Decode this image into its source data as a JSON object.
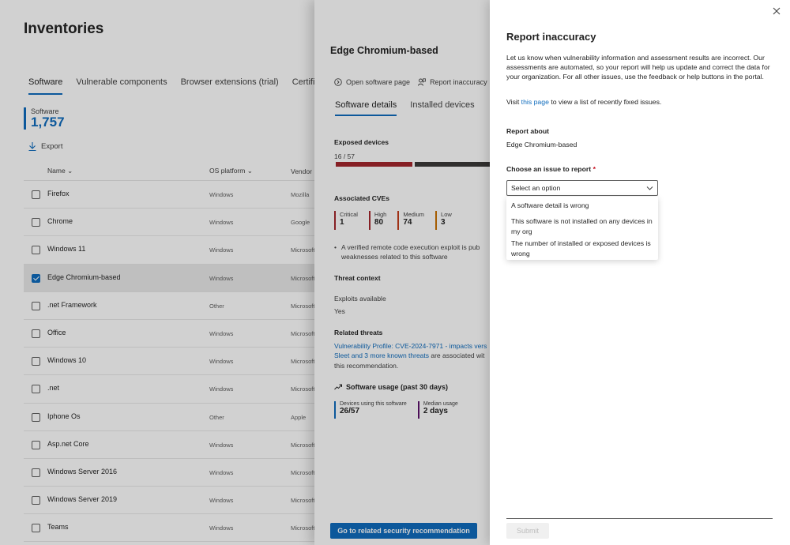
{
  "page": {
    "title": "Inventories",
    "tabs": [
      "Software",
      "Vulnerable components",
      "Browser extensions (trial)",
      "Certificates"
    ],
    "count_label": "Software",
    "count_value": "1,757",
    "export_label": "Export",
    "columns": {
      "name": "Name",
      "os": "OS platform",
      "vendor": "Vendor"
    },
    "rows": [
      {
        "name": "Firefox",
        "os": "Windows",
        "vendor": "Mozilla"
      },
      {
        "name": "Chrome",
        "os": "Windows",
        "vendor": "Google"
      },
      {
        "name": "Windows 11",
        "os": "Windows",
        "vendor": "Microsoft"
      },
      {
        "name": "Edge Chromium-based",
        "os": "Windows",
        "vendor": "Microsoft"
      },
      {
        "name": ".net Framework",
        "os": "Other",
        "vendor": "Microsoft"
      },
      {
        "name": "Office",
        "os": "Windows",
        "vendor": "Microsoft"
      },
      {
        "name": "Windows 10",
        "os": "Windows",
        "vendor": "Microsoft"
      },
      {
        "name": ".net",
        "os": "Windows",
        "vendor": "Microsoft"
      },
      {
        "name": "Iphone Os",
        "os": "Other",
        "vendor": "Apple"
      },
      {
        "name": "Asp.net Core",
        "os": "Windows",
        "vendor": "Microsoft"
      },
      {
        "name": "Windows Server 2016",
        "os": "Windows",
        "vendor": "Microsoft"
      },
      {
        "name": "Windows Server 2019",
        "os": "Windows",
        "vendor": "Microsoft"
      },
      {
        "name": "Teams",
        "os": "Windows",
        "vendor": "Microsoft"
      }
    ],
    "selected_row_index": 3
  },
  "panel": {
    "title": "Edge Chromium-based",
    "open_page": "Open software page",
    "report_inaccuracy": "Report inaccuracy",
    "tabs": [
      "Software details",
      "Installed devices"
    ],
    "exposed_devices_label": "Exposed devices",
    "exposed_fraction": "16 / 57",
    "exposed_count": 16,
    "total_devices": 57,
    "cves_label": "Associated CVEs",
    "cves": [
      {
        "label": "Critical",
        "value": "1",
        "color": "#a4262c"
      },
      {
        "label": "High",
        "value": "80",
        "color": "#a4262c"
      },
      {
        "label": "Medium",
        "value": "74",
        "color": "#c43e1c"
      },
      {
        "label": "Low",
        "value": "3",
        "color": "#ca7100"
      }
    ],
    "bullet_line1": "A verified remote code execution exploit is pub",
    "bullet_line2": "weaknesses related to this software",
    "threat_context": "Threat context",
    "exploits_label": "Exploits available",
    "exploits_value": "Yes",
    "related_threats": "Related threats",
    "threats_link1": "Vulnerability Profile: CVE-2024-7971 - impacts vers",
    "threats_link2": "Sleet and 3 more known threats",
    "threats_text2": " are associated wit",
    "threats_text3": "this recommendation.",
    "usage_title": "Software usage (past 30 days)",
    "usage": [
      {
        "label": "Devices using this software",
        "value": "26/57",
        "color": "#0f6cbd"
      },
      {
        "label": "Median usage",
        "value": "2 days",
        "color": "#5c126b"
      }
    ],
    "button": "Go to related security recommendation"
  },
  "dialog": {
    "title": "Report inaccuracy",
    "description": "Let us know when vulnerability information and assessment results are incorrect. Our assessments are automated, so your report will help us update and correct the data for your organization. For all other issues, use the feedback or help buttons in the portal.",
    "visit_prefix": "Visit ",
    "visit_link": "this page",
    "visit_suffix": " to view a list of recently fixed issues.",
    "report_about_label": "Report about",
    "report_about_value": "Edge Chromium-based",
    "issue_label": "Choose an issue to report",
    "required_mark": "*",
    "select_placeholder": "Select an option",
    "options": [
      "A software detail is wrong",
      "This software is not installed on any devices in my org",
      "The number of installed or exposed devices is wrong"
    ],
    "submit": "Submit"
  }
}
